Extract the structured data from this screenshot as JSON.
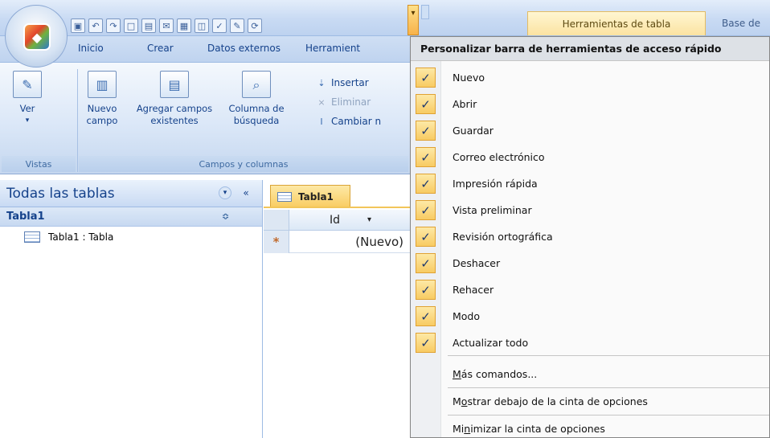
{
  "title_bar": {
    "contextual_tab": "Herramientas de tabla",
    "db_tab": "Base de"
  },
  "ribbon": {
    "tabs": [
      "Inicio",
      "Crear",
      "Datos externos",
      "Herramient"
    ],
    "buttons": {
      "ver": "Ver",
      "nuevo_campo_1": "Nuevo",
      "nuevo_campo_2": "campo",
      "agregar_1": "Agregar campos",
      "agregar_2": "existentes",
      "columna_1": "Columna de",
      "columna_2": "búsqueda",
      "insertar": "Insertar",
      "eliminar": "Eliminar",
      "cambiar": "Cambiar n"
    },
    "groups": {
      "vistas": "Vistas",
      "campos_columnas": "Campos y columnas"
    }
  },
  "nav_pane": {
    "header": "Todas las tablas",
    "group": "Tabla1",
    "item": "Tabla1 : Tabla"
  },
  "document": {
    "tab": "Tabla1",
    "column": "Id",
    "new_row_marker": "*",
    "new_row_value": "(Nuevo)"
  },
  "menu": {
    "title": "Personalizar barra de herramientas de acceso rápido",
    "items": [
      {
        "label": "Nuevo",
        "checked": true
      },
      {
        "label": "Abrir",
        "checked": true
      },
      {
        "label": "Guardar",
        "checked": true
      },
      {
        "label": "Correo electrónico",
        "checked": true
      },
      {
        "label": "Impresión rápida",
        "checked": true
      },
      {
        "label": "Vista preliminar",
        "checked": true
      },
      {
        "label": "Revisión ortográfica",
        "checked": true
      },
      {
        "label": "Deshacer",
        "checked": true
      },
      {
        "label": "Rehacer",
        "checked": true
      },
      {
        "label": "Modo",
        "checked": true
      },
      {
        "label": "Actualizar todo",
        "checked": true
      }
    ],
    "more_commands": {
      "pre": "",
      "key": "M",
      "post": "ás comandos..."
    },
    "show_below": {
      "pre": "M",
      "key": "o",
      "post": "strar debajo de la cinta de opciones"
    },
    "minimize": {
      "pre": "Mi",
      "key": "n",
      "post": "imizar la cinta de opciones"
    }
  }
}
